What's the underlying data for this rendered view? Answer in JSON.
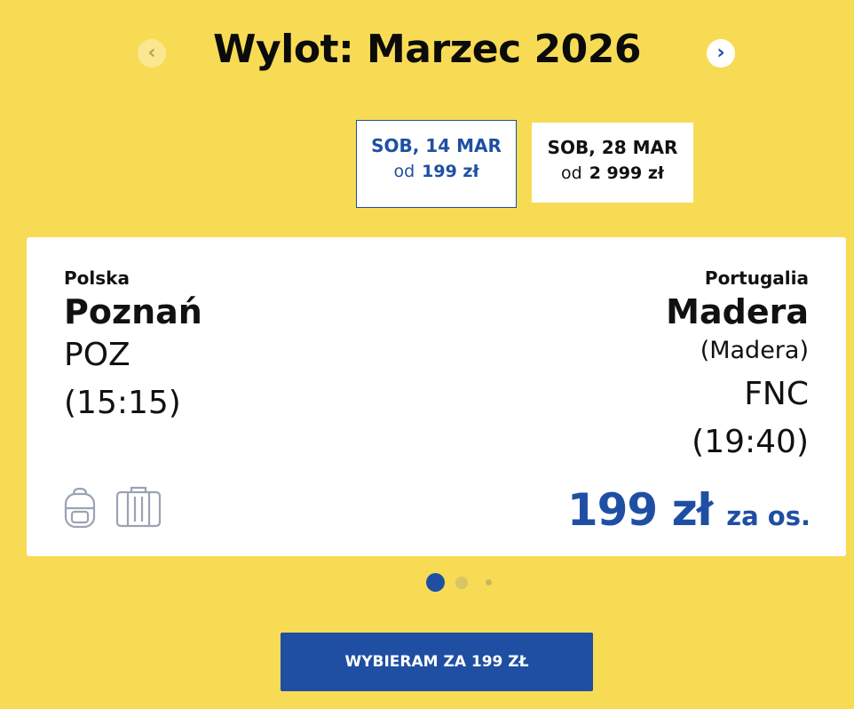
{
  "header": {
    "title": "Wylot: Marzec 2026",
    "prev_icon": "chevron-left-icon",
    "next_icon": "chevron-right-icon"
  },
  "dates": [
    {
      "day": "SOB, 14 MAR",
      "from_label": "od",
      "price": "199 zł",
      "selected": true
    },
    {
      "day": "SOB, 28 MAR",
      "from_label": "od",
      "price": "2 999 zł",
      "selected": false
    }
  ],
  "flight": {
    "origin": {
      "country": "Polska",
      "city": "Poznań",
      "code": "POZ",
      "time": "(15:15)"
    },
    "destination": {
      "country": "Portugalia",
      "city": "Madera",
      "region": "(Madera)",
      "code": "FNC",
      "time": "(19:40)"
    },
    "price": "199 zł",
    "price_suffix": "za os.",
    "icons": [
      "backpack-icon",
      "suitcase-icon"
    ]
  },
  "pagination": {
    "total": 3,
    "active": 1
  },
  "cta": {
    "label": "WYBIERAM ZA 199 ZŁ"
  },
  "colors": {
    "background": "#f8db55",
    "accent": "#1f4fa3",
    "card": "#ffffff"
  }
}
